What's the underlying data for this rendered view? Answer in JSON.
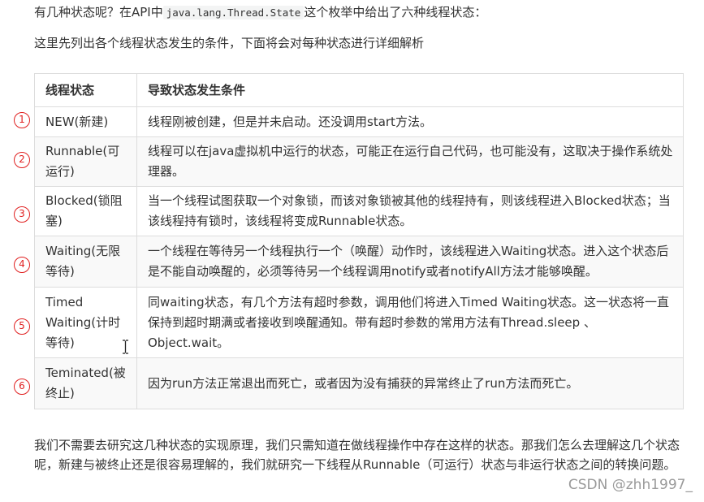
{
  "intro": {
    "line1_before": "有几种状态呢？在API中",
    "line1_code": "java.lang.Thread.State",
    "line1_after": "这个枚举中给出了六种线程状态：",
    "line2": "这里先列出各个线程状态发生的条件，下面将会对每种状态进行详细解析"
  },
  "table": {
    "headers": [
      "线程状态",
      "导致状态发生条件"
    ],
    "rows": [
      {
        "marker": "1",
        "state": "NEW(新建)",
        "condition": "线程刚被创建，但是并未启动。还没调用start方法。"
      },
      {
        "marker": "2",
        "state": "Runnable(可运行)",
        "condition": "线程可以在java虚拟机中运行的状态，可能正在运行自己代码，也可能没有，这取决于操作系统处理器。"
      },
      {
        "marker": "3",
        "state": "Blocked(锁阻塞)",
        "condition": "当一个线程试图获取一个对象锁，而该对象锁被其他的线程持有，则该线程进入Blocked状态；当该线程持有锁时，该线程将变成Runnable状态。"
      },
      {
        "marker": "4",
        "state": "Waiting(无限等待)",
        "condition": "一个线程在等待另一个线程执行一个（唤醒）动作时，该线程进入Waiting状态。进入这个状态后是不能自动唤醒的，必须等待另一个线程调用notify或者notifyAll方法才能够唤醒。"
      },
      {
        "marker": "5",
        "state": "Timed Waiting(计时等待)",
        "condition": "同waiting状态，有几个方法有超时参数，调用他们将进入Timed Waiting状态。这一状态将一直保持到超时期满或者接收到唤醒通知。带有超时参数的常用方法有Thread.sleep 、Object.wait。"
      },
      {
        "marker": "6",
        "state": "Teminated(被终止)",
        "condition": "因为run方法正常退出而死亡，或者因为没有捕获的异常终止了run方法而死亡。"
      }
    ]
  },
  "outro": "我们不需要去研究这几种状态的实现原理，我们只需知道在做线程操作中存在这样的状态。那我们怎么去理解这几个状态呢，新建与被终止还是很容易理解的，我们就研究一下线程从Runnable（可运行）状态与非运行状态之间的转换问题。",
  "watermark": "CSDN @zhh1997_",
  "colors": {
    "marker": "#e02020",
    "border": "#dddddd",
    "stripe": "#f9f9f9"
  }
}
